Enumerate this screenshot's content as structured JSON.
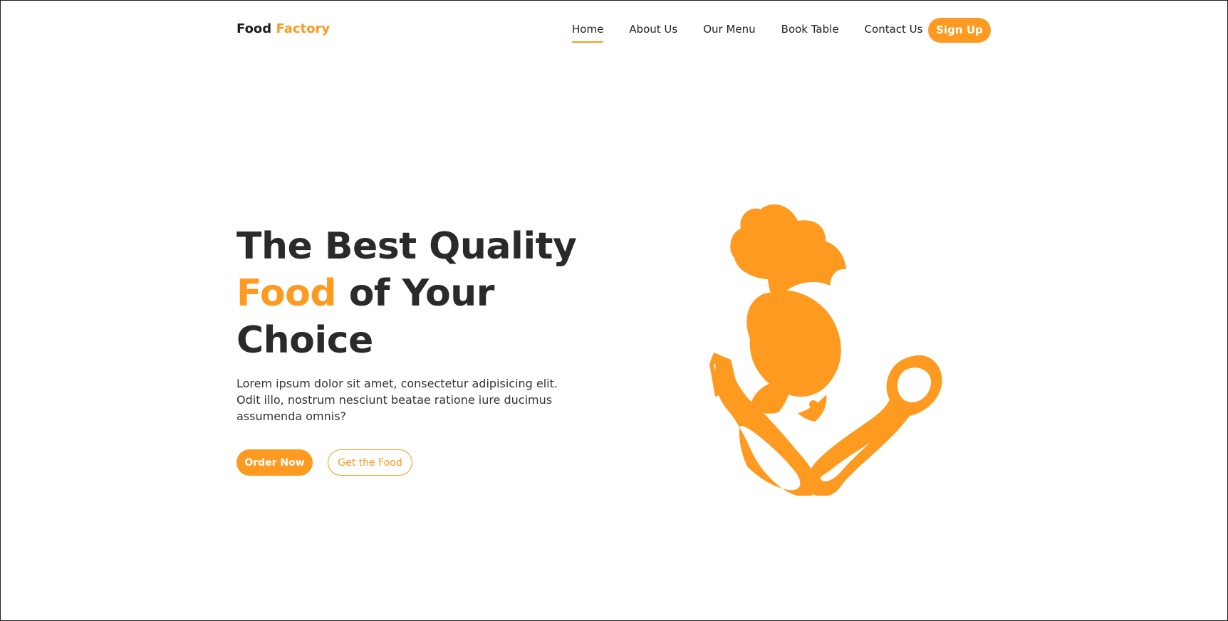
{
  "brand": {
    "primary": "Food",
    "accent": "Factory",
    "accent_color": "#ff9a20"
  },
  "navigation": {
    "items": [
      {
        "label": "Home",
        "active": true
      },
      {
        "label": "About Us",
        "active": false
      },
      {
        "label": "Our Menu",
        "active": false
      },
      {
        "label": "Book Table",
        "active": false
      },
      {
        "label": "Contact Us",
        "active": false
      }
    ],
    "signup_label": "Sign Up"
  },
  "hero": {
    "title_line1": "The Best Quality",
    "title_accent": "Food",
    "title_line2_rest": " of Your",
    "title_line3": "Choice",
    "description": "Lorem ipsum dolor sit amet, consectetur adipisicing elit. Odit illo, nostrum nesciunt beatae ratione iure ducimus assumenda omnis?",
    "primary_button": "Order Now",
    "secondary_button": "Get the Food",
    "illustration_icon": "chef-with-fork-and-spoon-icon"
  },
  "colors": {
    "accent": "#ff9a20",
    "heading": "#2a2a2a",
    "background": "#ffffff"
  }
}
